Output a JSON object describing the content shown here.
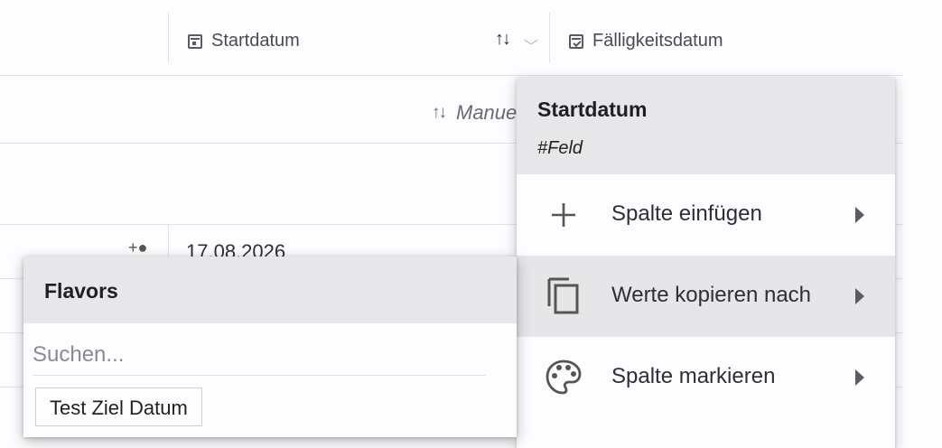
{
  "table": {
    "columns": [
      {
        "label": "Startdatum",
        "icon": "calendar-icon"
      },
      {
        "label": "Fälligkeitsdatum",
        "icon": "calendar-check-icon"
      }
    ],
    "sort_label": "Manue",
    "rows": [
      {
        "date": "17.08.2026"
      }
    ]
  },
  "context_menu": {
    "title": "Startdatum",
    "subtitle": "#Feld",
    "items": [
      {
        "label": "Spalte einfügen",
        "icon": "plus-icon"
      },
      {
        "label": "Werte kopieren nach",
        "icon": "copy-icon",
        "active": true
      },
      {
        "label": "Spalte markieren",
        "icon": "palette-icon"
      }
    ]
  },
  "flavors": {
    "title": "Flavors",
    "search_placeholder": "Suchen...",
    "options": [
      {
        "label": "Test Ziel Datum"
      }
    ]
  }
}
